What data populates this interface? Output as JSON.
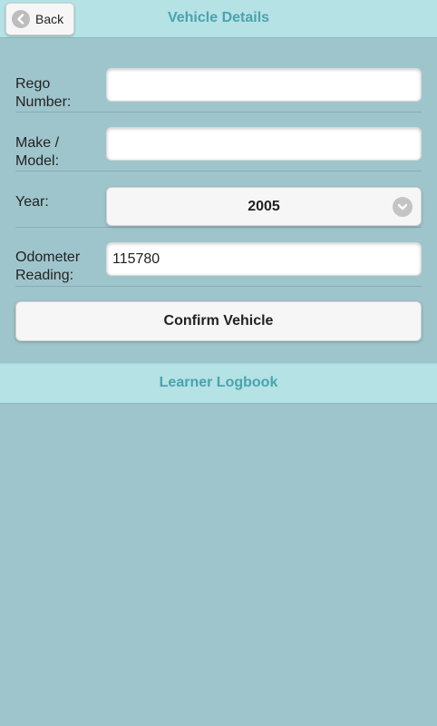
{
  "header": {
    "back_label": "Back",
    "title": "Vehicle Details"
  },
  "form": {
    "rego": {
      "label_line1": "Rego",
      "label_line2": "Number:",
      "value": ""
    },
    "make": {
      "label_line1": "Make /",
      "label_line2": "Model:",
      "value": ""
    },
    "year": {
      "label": "Year:",
      "value": "2005"
    },
    "odometer": {
      "label_line1": "Odometer",
      "label_line2": "Reading:",
      "value": "115780"
    }
  },
  "confirm_label": "Confirm Vehicle",
  "footer": {
    "title": "Learner Logbook"
  },
  "icons": {
    "back": "chevron-left-icon",
    "select": "chevron-down-icon"
  },
  "colors": {
    "background": "#9fc5cc",
    "bar": "#b5e2e4",
    "accent_text": "#4aa3ad"
  }
}
